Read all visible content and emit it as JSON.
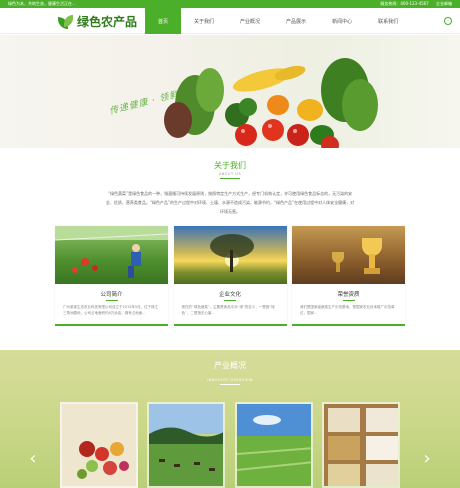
{
  "topbar": {
    "left_text": "绿色为本，共筑生态，健康生活正在...",
    "hotline": "服务热线：400-123-4567",
    "enterprise_mail": "企业邮箱"
  },
  "header": {
    "logo_text": "绿色农产品",
    "nav": [
      {
        "label": "首页",
        "active": true
      },
      {
        "label": "关于我们",
        "active": false
      },
      {
        "label": "产业概况",
        "active": false
      },
      {
        "label": "产品展示",
        "active": false
      },
      {
        "label": "新闻中心",
        "active": false
      },
      {
        "label": "联系我们",
        "active": false
      }
    ]
  },
  "hero": {
    "slogan": "传递健康 · 领鲜一步"
  },
  "about": {
    "title": "关于我们",
    "subtitle": "ABOUT US",
    "intro": "“绿色蔬菜”是绿色食品的一种，指遵循可持续发展原则，按照特定生产方式生产，经专门机构认定，许可使用绿色食品标志的，无污染的安全、优质、营养类食品。“绿色产品”的生产过程中对环境、土壤、水源不造成污染，能源节约，“绿色产品”在使用过程中对人体安全健康，对环境无害。",
    "cards": [
      {
        "title": "公司简介",
        "text": "广州某某生态农业科技有限公司成立于2015年5月，位于珠江三角洲腹地，公司占地面积约6万余亩，拥有占地面..."
      },
      {
        "title": "企业文化",
        "text": "现在的“绿色蔬菜”，主要是食品中对“绿”的定义，一是指“绿色”，二是指无公害..."
      },
      {
        "title": "荣誉资质",
        "text": "我们是国家级蔬菜生产示范基地，是国家农业技术推广示范单位，国家..."
      }
    ]
  },
  "overview": {
    "title": "产业概况",
    "subtitle": "INDUSTRY OVERVIEW",
    "prev_icon": "chevron-left-icon",
    "next_icon": "chevron-right-icon"
  },
  "colors": {
    "brand_green": "#4caf2a"
  }
}
